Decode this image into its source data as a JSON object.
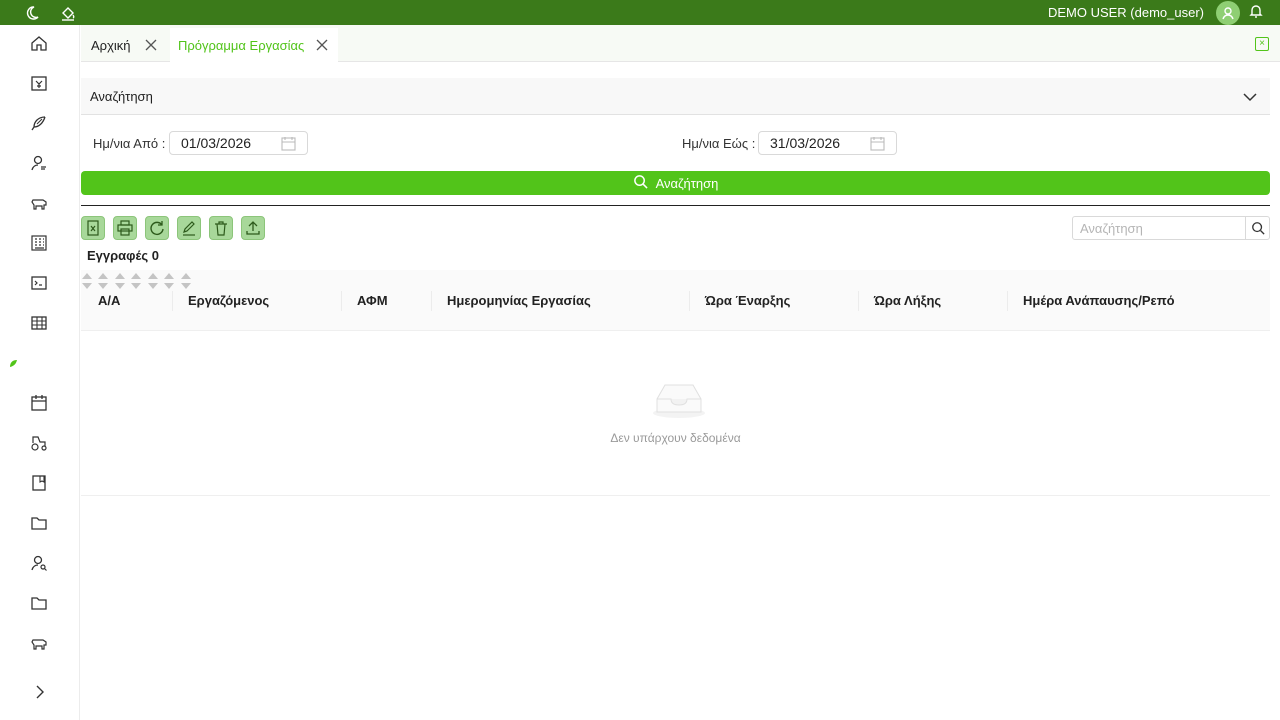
{
  "topbar": {
    "user_label": "DEMO USER (demo_user)",
    "icons": [
      "moon-icon",
      "paint-bucket-icon",
      "avatar-icon",
      "bell-icon"
    ],
    "background": "#3b7a1a"
  },
  "sidebar": {
    "items": [
      {
        "icon": "home-icon"
      },
      {
        "icon": "calendar-yen-icon"
      },
      {
        "icon": "feather-icon"
      },
      {
        "icon": "user-search-icon"
      },
      {
        "icon": "cattle-icon"
      },
      {
        "icon": "building-icon"
      },
      {
        "icon": "terminal-icon"
      },
      {
        "icon": "table-icon"
      },
      {
        "icon": "leaf-icon"
      },
      {
        "icon": "calendar-icon"
      },
      {
        "icon": "tractor-icon"
      },
      {
        "icon": "book-icon"
      },
      {
        "icon": "folder-icon"
      },
      {
        "icon": "users-search-icon"
      },
      {
        "icon": "folder-icon"
      },
      {
        "icon": "cattle-icon"
      }
    ],
    "expand_icon": "chevron-right-icon"
  },
  "tabs": [
    {
      "label": "Αρχική",
      "active": false
    },
    {
      "label": "Πρόγραμμα Εργασίας",
      "active": true
    }
  ],
  "search_panel": {
    "title": "Αναζήτηση",
    "date_from_label": "Ημ/νια Από :",
    "date_from_value": "01/03/2026",
    "date_to_label": "Ημ/νια Εώς :",
    "date_to_value": "31/03/2026",
    "search_button_label": "Αναζήτηση"
  },
  "toolbar": {
    "buttons": [
      "excel-icon",
      "print-icon",
      "refresh-icon",
      "edit-icon",
      "delete-icon",
      "upload-icon"
    ],
    "search_placeholder": "Αναζήτηση"
  },
  "records_label": "Εγγραφές 0",
  "table": {
    "columns": [
      "Α/Α",
      "Εργαζόμενος",
      "ΑΦΜ",
      "Ημερομηνίας Εργασίας",
      "Ώρα Έναρξης",
      "Ώρα Λήξης",
      "Ημέρα Ανάπαυσης/Ρεπό"
    ],
    "rows": [],
    "empty_text": "Δεν υπάρχουν δεδομένα"
  },
  "colors": {
    "accent": "#52c41a",
    "header_green": "#3b7a1a",
    "tool_button": "#a8d89a"
  }
}
